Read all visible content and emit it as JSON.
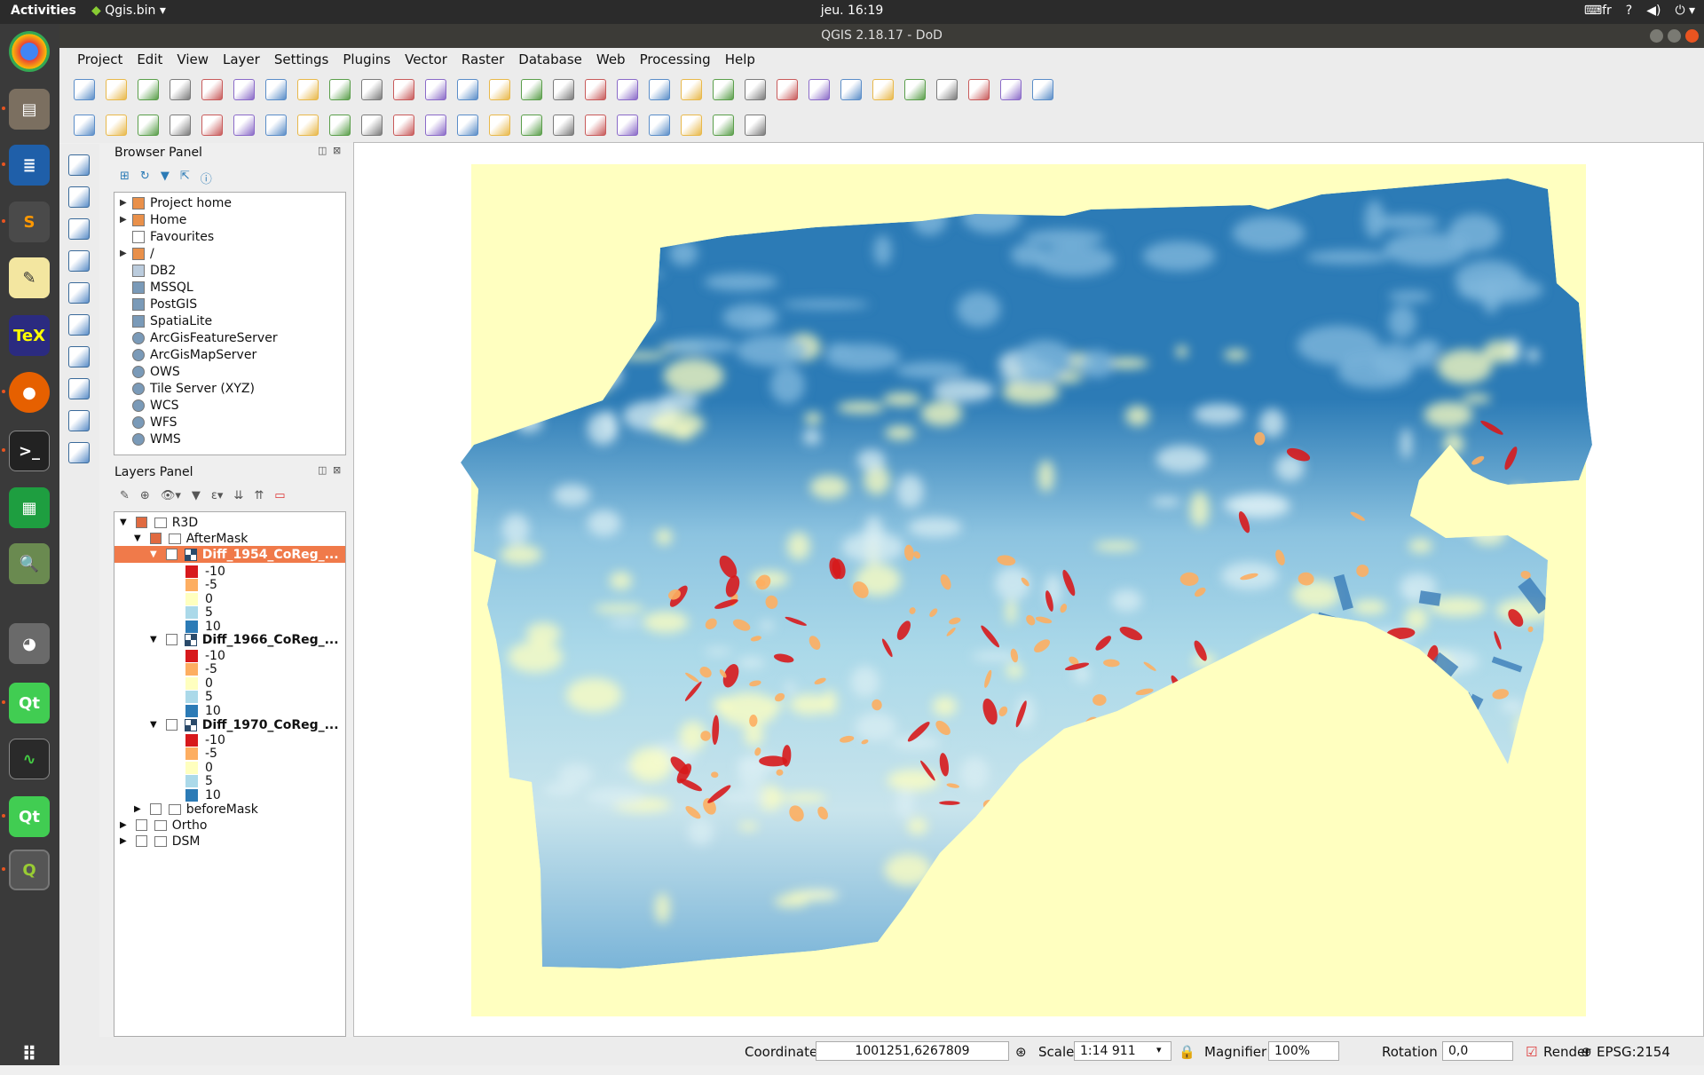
{
  "topbar": {
    "activities": "Activities",
    "app": "Qgis.bin",
    "clock": "jeu. 16:19",
    "lang": "fr"
  },
  "window": {
    "title": "QGIS 2.18.17 - DoD"
  },
  "menu": [
    "Project",
    "Edit",
    "View",
    "Layer",
    "Settings",
    "Plugins",
    "Vector",
    "Raster",
    "Database",
    "Web",
    "Processing",
    "Help"
  ],
  "browser": {
    "title": "Browser Panel",
    "items": [
      "Project home",
      "Home",
      "Favourites",
      "/",
      "DB2",
      "MSSQL",
      "PostGIS",
      "SpatiaLite",
      "ArcGisFeatureServer",
      "ArcGisMapServer",
      "OWS",
      "Tile Server (XYZ)",
      "WCS",
      "WFS",
      "WMS"
    ]
  },
  "layers": {
    "title": "Layers Panel",
    "group": "R3D",
    "subgroup": "AfterMask",
    "layer1": "Diff_1954_CoReg_...",
    "layer2": "Diff_1966_CoReg_...",
    "layer3": "Diff_1970_CoReg_...",
    "before": "beforeMask",
    "ortho": "Ortho",
    "dsm": "DSM",
    "legend": [
      "-10",
      "-5",
      "0",
      "5",
      "10"
    ]
  },
  "colors": {
    "neg10": "#d7191c",
    "neg5": "#fdae61",
    "zero": "#ffffbf",
    "pos5": "#abd9e9",
    "pos10": "#2c7bb6",
    "map_bg": "#ffffc0",
    "highlight": "#f07a4a"
  },
  "status": {
    "coord_label": "Coordinate",
    "coord": "1001251,6267809",
    "scale_label": "Scale",
    "scale": "1:14 911",
    "mag_label": "Magnifier",
    "mag": "100%",
    "rot_label": "Rotation",
    "rot": "0,0",
    "render": "Render",
    "crs": "EPSG:2154"
  },
  "toolbar1": [
    "new-project",
    "open-project",
    "save-project",
    "save-as",
    "new-print-composer",
    "composer-manager",
    "pan",
    "pan-to-selection",
    "zoom-in",
    "zoom-out",
    "zoom-native",
    "zoom-full",
    "zoom-layer",
    "zoom-selection",
    "zoom-last",
    "zoom-next",
    "new-bookmark",
    "show-bookmarks",
    "refresh",
    "identify",
    "measure-tool",
    "select",
    "deselect",
    "field-calculator",
    "attribute-table",
    "statistics",
    "sum",
    "measure",
    "map-tips",
    "text-annotation",
    "help"
  ],
  "toolbar2": [
    "current-edits",
    "toggle-editing",
    "save-edits",
    "add-feature",
    "move-feature",
    "node-tool",
    "delete-selected",
    "cut",
    "copy",
    "paste",
    "label",
    "pin-labels",
    "show-hide-labels",
    "move-label",
    "rotate-label",
    "change-label",
    "label-toolbar-a",
    "label-toolbar-b",
    "label-toolbar-c",
    "csw",
    "python-console",
    "profile-tool"
  ],
  "sidebar_tools": [
    "add-vector",
    "add-raster",
    "add-spatialite",
    "add-postgis",
    "add-wms",
    "add-wcs",
    "add-wfs",
    "add-delimited",
    "add-virtual",
    "new-shapefile"
  ]
}
